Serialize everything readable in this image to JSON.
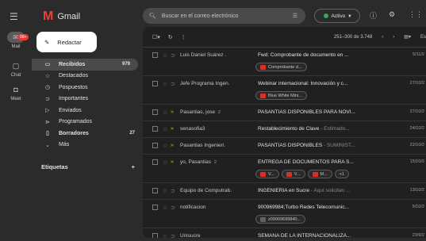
{
  "app": {
    "name": "Gmail"
  },
  "rail": {
    "mail": "Mail",
    "badge": "99+",
    "chat": "Chat",
    "meet": "Meet"
  },
  "compose": {
    "label": "Redactar"
  },
  "nav": [
    {
      "label": "Recibidos",
      "count": "979",
      "selected": true,
      "icon": "inbox-icon"
    },
    {
      "label": "Destacados",
      "count": "",
      "icon": "star-icon"
    },
    {
      "label": "Pospuestos",
      "count": "",
      "icon": "clock-icon"
    },
    {
      "label": "Importantes",
      "count": "",
      "icon": "important-icon"
    },
    {
      "label": "Enviados",
      "count": "",
      "icon": "send-icon"
    },
    {
      "label": "Programados",
      "count": "",
      "icon": "scheduled-icon"
    },
    {
      "label": "Borradores",
      "count": "27",
      "bold": true,
      "icon": "draft-icon"
    },
    {
      "label": "Más",
      "count": "",
      "icon": "chevron-down-icon"
    }
  ],
  "labels": {
    "title": "Etiquetas",
    "add": "+"
  },
  "search": {
    "placeholder": "Buscar en el correo electrónico"
  },
  "status": {
    "label": "Activo"
  },
  "toolbar": {
    "range": "251–300 de 3.748",
    "lang": "Es"
  },
  "emails": [
    {
      "from": "Luis Daniel Suárez .",
      "subject": "Fwd: Comprobante de documento en ...",
      "preview": "",
      "date": "5/11/2",
      "important": false,
      "attachments": [
        "Comprobante d..."
      ]
    },
    {
      "from": "Jefe Programa Ingen.",
      "subject": "Webinar internacional: Innovación y c...",
      "preview": "",
      "date": "27/10/2",
      "important": false,
      "attachments": [
        "Blue White Mini..."
      ]
    },
    {
      "from": "Pasantias, jose",
      "count": "2",
      "subject": "PASANTIAS DISPONIBLES PARA NOVI...",
      "preview": "",
      "date": "27/10/2",
      "important": true,
      "attachments": []
    },
    {
      "from": "senasofia3",
      "subject": "Restablecimiento de Clave",
      "preview": " - Estimado...",
      "date": "24/10/2",
      "important": true,
      "attachments": []
    },
    {
      "from": "Pasantias Ingenieri.",
      "subject": "PASANTIAS DISPONIBLES",
      "preview": " - SUMINIST...",
      "date": "22/10/2",
      "important": true,
      "attachments": []
    },
    {
      "from": "yo, Pasantias",
      "count": "2",
      "subject": "ENTREGA DE DOCUMENTOS PARA S...",
      "preview": "",
      "date": "15/10/2",
      "important": true,
      "attachments": [
        "V...",
        "V...",
        "M..."
      ],
      "more": "+1"
    },
    {
      "from": "Equipo de Computrab.",
      "subject": "INGENIERIA en Sucre",
      "preview": " - Aquí solicitan ...",
      "date": "13/10/2",
      "important": false,
      "attachments": []
    },
    {
      "from": "notificacion",
      "subject": "900969984;Turbo Redes Telecomunic...",
      "preview": "",
      "date": "5/10/2",
      "important": false,
      "attachments": [
        "z09009699840..."
      ],
      "gray": true
    },
    {
      "from": "Unisucre",
      "subject": "SEMANA DE LA INTERNACIONALIZA...",
      "preview": "",
      "date": "23/9/2",
      "important": false,
      "attachments": []
    }
  ]
}
